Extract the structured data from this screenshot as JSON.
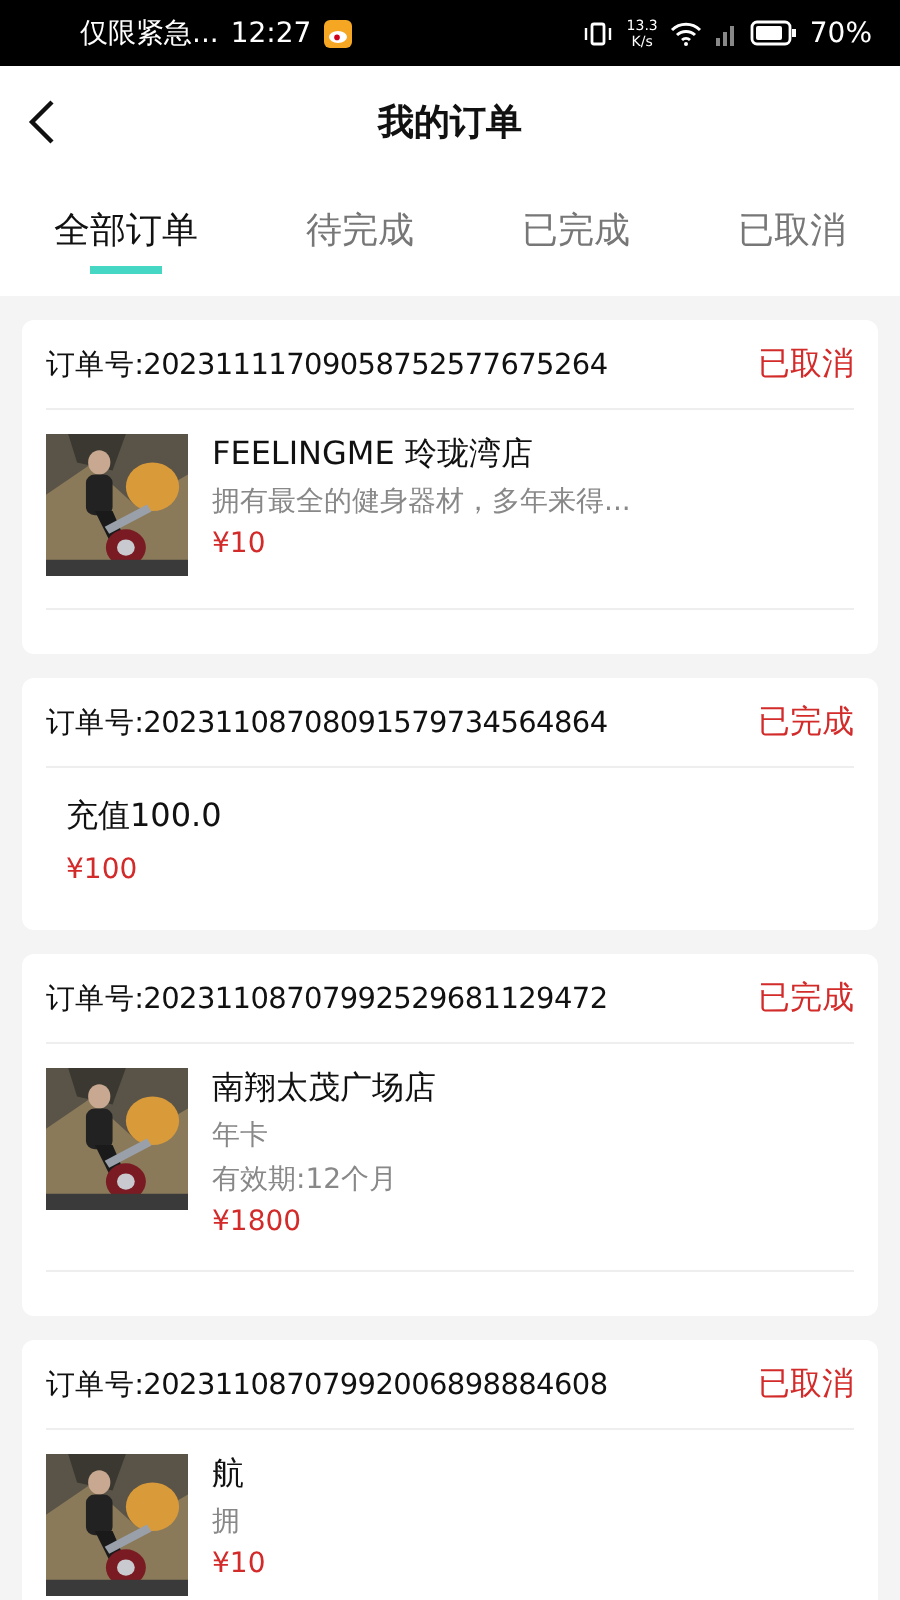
{
  "status_bar": {
    "notification": "仅限紧急...",
    "time": "12:27",
    "speed_value": "13.3",
    "speed_unit": "K/s",
    "battery": "70%"
  },
  "header": {
    "title": "我的订单"
  },
  "tabs": [
    {
      "label": "全部订单",
      "selected": true
    },
    {
      "label": "待完成",
      "selected": false
    },
    {
      "label": "已完成",
      "selected": false
    },
    {
      "label": "已取消",
      "selected": false
    }
  ],
  "orders": [
    {
      "order_no": "订单号:20231111709058752577675264",
      "status": "已取消",
      "kind": "store",
      "name": "FEELINGME 玲珑湾店",
      "lines": [
        "拥有最全的健身器材，多年来得..."
      ],
      "price": "¥10"
    },
    {
      "order_no": "订单号:20231108708091579734564864",
      "status": "已完成",
      "kind": "recharge",
      "name": "充值100.0",
      "price": "¥100"
    },
    {
      "order_no": "订单号:20231108707992529681129472",
      "status": "已完成",
      "kind": "store",
      "name": "南翔太茂广场店",
      "lines": [
        "年卡",
        "有效期:12个月"
      ],
      "price": "¥1800"
    },
    {
      "order_no": "订单号:20231108707992006898884608",
      "status": "已取消",
      "kind": "store",
      "name": "航",
      "lines": [
        "拥"
      ],
      "price": "¥10"
    }
  ]
}
